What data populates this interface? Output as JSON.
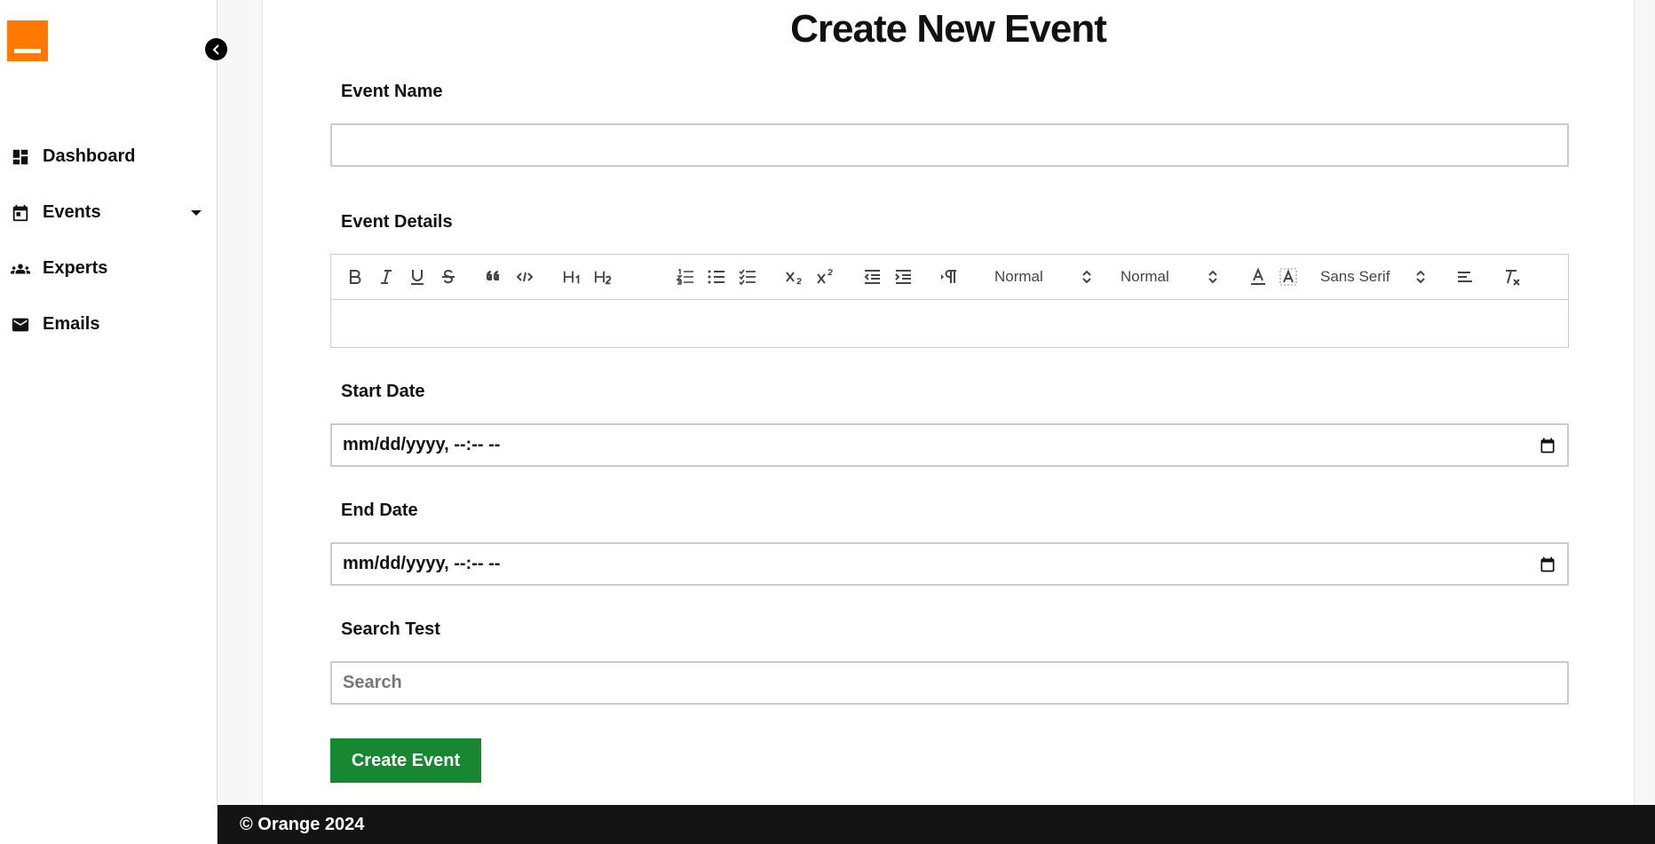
{
  "sidebar": {
    "items": [
      {
        "label": "Dashboard",
        "icon": "dashboard-icon"
      },
      {
        "label": "Events",
        "icon": "calendar-icon",
        "has_dropdown": true
      },
      {
        "label": "Experts",
        "icon": "people-icon"
      },
      {
        "label": "Emails",
        "icon": "mail-icon"
      }
    ]
  },
  "page": {
    "title": "Create New Event"
  },
  "form": {
    "event_name": {
      "label": "Event Name",
      "value": "",
      "placeholder": ""
    },
    "event_details": {
      "label": "Event Details",
      "toolbar": {
        "header_size": "Normal",
        "text_size": "Normal",
        "font": "Sans Serif"
      }
    },
    "start_date": {
      "label": "Start Date",
      "value": "mm/dd/yyyy, --:-- --"
    },
    "end_date": {
      "label": "End Date",
      "value": "mm/dd/yyyy, --:-- --"
    },
    "search": {
      "label": "Search Test",
      "placeholder": "Search"
    },
    "submit_label": "Create Event"
  },
  "footer": {
    "text": "© Orange 2024"
  },
  "colors": {
    "brand": "#ff7900",
    "submit": "#178732",
    "footer_bg": "#141414"
  }
}
